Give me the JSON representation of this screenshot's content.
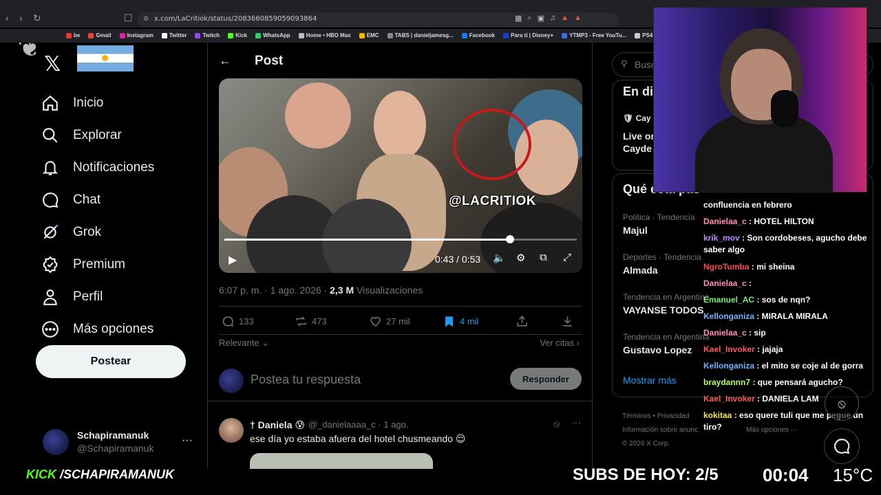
{
  "browser": {
    "url": "x.com/LaCritiok/status/2083660859059093864",
    "bookmarks": [
      "be",
      "Gmail",
      "Instagram",
      "Twitter",
      "Twitch",
      "Kick",
      "WhatsApp",
      "Home • HBO Max",
      "EMC",
      "TABS | danieljamesg...",
      "Facebook",
      "Para ti | Disney+",
      "YTMP3 - Free YouTu...",
      "PS4 Archives - D"
    ]
  },
  "sidebar": {
    "items": [
      {
        "label": "Inicio",
        "icon": "home-icon"
      },
      {
        "label": "Explorar",
        "icon": "search-icon"
      },
      {
        "label": "Notificaciones",
        "icon": "bell-icon"
      },
      {
        "label": "Chat",
        "icon": "chat-icon"
      },
      {
        "label": "Grok",
        "icon": "grok-icon"
      },
      {
        "label": "Premium",
        "icon": "premium-icon"
      },
      {
        "label": "Perfil",
        "icon": "profile-icon"
      },
      {
        "label": "Más opciones",
        "icon": "more-icon"
      }
    ],
    "post_button": "Postear",
    "account": {
      "name": "Schapiramanuk",
      "handle": "@Schapiramanuk"
    }
  },
  "post": {
    "header": "Post",
    "video": {
      "watermark": "@LACRITIOK",
      "time": "0:43 / 0:53",
      "progress": 0.81
    },
    "meta": {
      "time": "6:07 p. m. · 1 ago. 2026 · ",
      "views": "2,3 M",
      "views_label": " Visualizaciones"
    },
    "stats": {
      "replies": "133",
      "reposts": "473",
      "likes": "27 mil",
      "bookmarks": "4 mil"
    },
    "sort_label": "Relevante",
    "quotes_label": "Ver citas",
    "reply_placeholder": "Postea tu respuesta",
    "reply_button": "Responder",
    "comment": {
      "name": "† Daniela 😰",
      "handle": "@_danielaaaa_c · 1 ago.",
      "text": "ese día yo estaba afuera del hotel chusmeando 😌"
    }
  },
  "right": {
    "search_placeholder": "Busc",
    "live": {
      "title": "En di",
      "host": "Cay",
      "line1": "Live on",
      "line2": "Cayde"
    },
    "trends_title": "Qué está pas",
    "trends": [
      {
        "category": "Política · Tendencia",
        "name": "Majul"
      },
      {
        "category": "Deportes · Tendencia",
        "name": "Almada"
      },
      {
        "category": "Tendencia en Argentina",
        "name": "VAYANSE TODOS"
      },
      {
        "category": "Tendencia en Argentina",
        "name": "Gustavo Lopez"
      }
    ],
    "show_more": "Mostrar más",
    "footer": {
      "links": "Términos     •     Privacidad",
      "line2": "Información sobre anunc",
      "more": "Más opciones ···",
      "copyright": "© 2026 X Corp."
    }
  },
  "chat": {
    "messages": [
      {
        "user": "",
        "text": "confluencia en febrero",
        "color": "#ffffff"
      },
      {
        "user": "Danielaa_c",
        "text": " : HOTEL HILTON",
        "color": "#ff8fb3"
      },
      {
        "user": "krik_mov",
        "text": " : Son cordobeses, agucho debe saber algo",
        "color": "#b98cff"
      },
      {
        "user": "NgroTumba",
        "text": " : mi sheina",
        "color": "#ff4a4a"
      },
      {
        "user": "Danielaa_c",
        "text": " : ",
        "color": "#ff8fb3"
      },
      {
        "user": "Emanuel_AC",
        "text": " : sos de nqn?",
        "color": "#6ef06e"
      },
      {
        "user": "Kellonganiza",
        "text": " : MIRALA MIRALA",
        "color": "#6db5ff"
      },
      {
        "user": "Danielaa_c",
        "text": " : sip",
        "color": "#ff8fb3"
      },
      {
        "user": "Kael_Invoker",
        "text": " : jajaja",
        "color": "#ff5a5a"
      },
      {
        "user": "Kellonganiza",
        "text": " : el mito se coje al de gorra",
        "color": "#6db5ff"
      },
      {
        "user": "braydannn7",
        "text": " : que pensará agucho?",
        "color": "#b4ff5a"
      },
      {
        "user": "Kael_Invoker",
        "text": " : DANIELA LAM",
        "color": "#ff5a5a"
      },
      {
        "user": "kokitaa",
        "text": " : eso quere tuli que me pegue un tiro?",
        "color": "#f4e84a"
      }
    ]
  },
  "overlay": {
    "kick_brand": "KICK",
    "kick_channel": " /SCHAPIRAMANUK",
    "subs": "SUBS DE HOY: 2/5",
    "clock": "00:04",
    "temp": "15°C"
  },
  "colors": {
    "accent": "#1d9bf0",
    "kick_green": "#53fc18",
    "background": "#000000",
    "border": "#2f3336"
  }
}
